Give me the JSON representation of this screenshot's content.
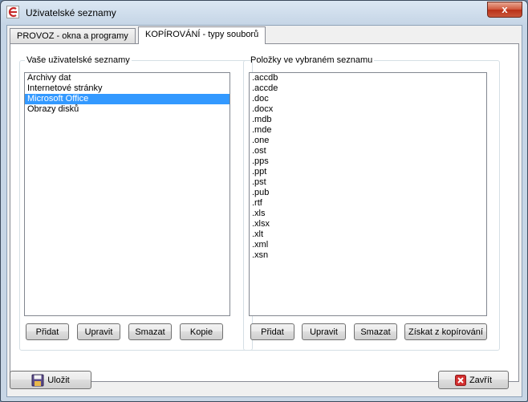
{
  "window": {
    "title": "Uživatelské seznamy",
    "close_glyph": "x"
  },
  "tabs": [
    {
      "label": "PROVOZ - okna a programy",
      "active": false
    },
    {
      "label": "KOPÍROVÁNÍ - typy souborů",
      "active": true
    }
  ],
  "left_group": {
    "legend": "Vaše uživatelské seznamy",
    "items": [
      "Archivy dat",
      "Internetové stránky",
      "Microsoft Office",
      "Obrazy disků"
    ],
    "selected_index": 2,
    "buttons": {
      "add": "Přidat",
      "edit": "Upravit",
      "delete": "Smazat",
      "copy": "Kopie"
    }
  },
  "right_group": {
    "legend": "Položky ve vybraném seznamu",
    "items": [
      ".accdb",
      ".accde",
      ".doc",
      ".docx",
      ".mdb",
      ".mde",
      ".one",
      ".ost",
      ".pps",
      ".ppt",
      ".pst",
      ".pub",
      ".rtf",
      ".xls",
      ".xlsx",
      ".xlt",
      ".xml",
      ".xsn"
    ],
    "buttons": {
      "add": "Přidat",
      "edit": "Upravit",
      "delete": "Smazat",
      "fetch": "Získat z kopírování"
    }
  },
  "footer": {
    "save": "Uložit",
    "close": "Zavřít"
  },
  "icons": {
    "save": "floppy-disk-icon",
    "close": "red-x-icon",
    "app": "app-logo-icon"
  },
  "colors": {
    "selection": "#3399ff",
    "close_button": "#c9553a"
  }
}
